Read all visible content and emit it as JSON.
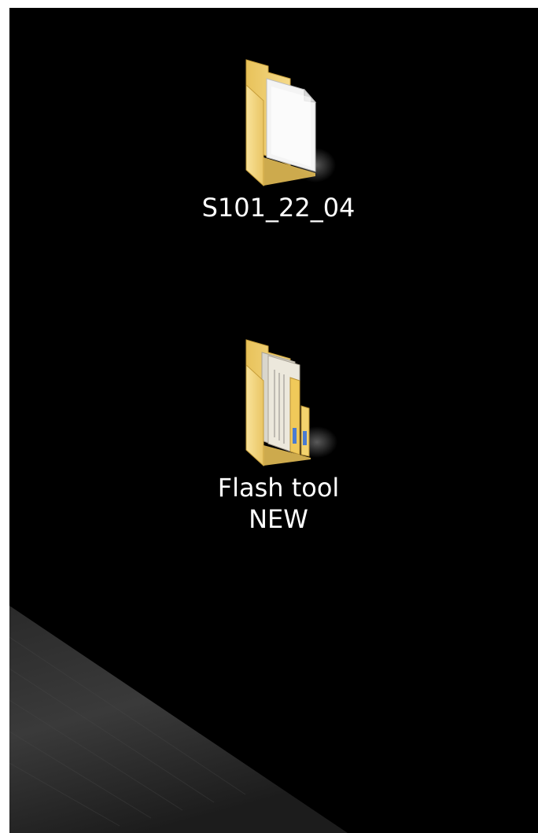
{
  "desktop": {
    "background_color": "#000000",
    "icons": [
      {
        "label": "S101_22_04",
        "icon": "folder-with-document-icon",
        "folder_color": "#F6D77A"
      },
      {
        "label": "Flash tool\nNEW",
        "icon": "folder-with-files-icon",
        "folder_color": "#F6D77A"
      }
    ]
  }
}
